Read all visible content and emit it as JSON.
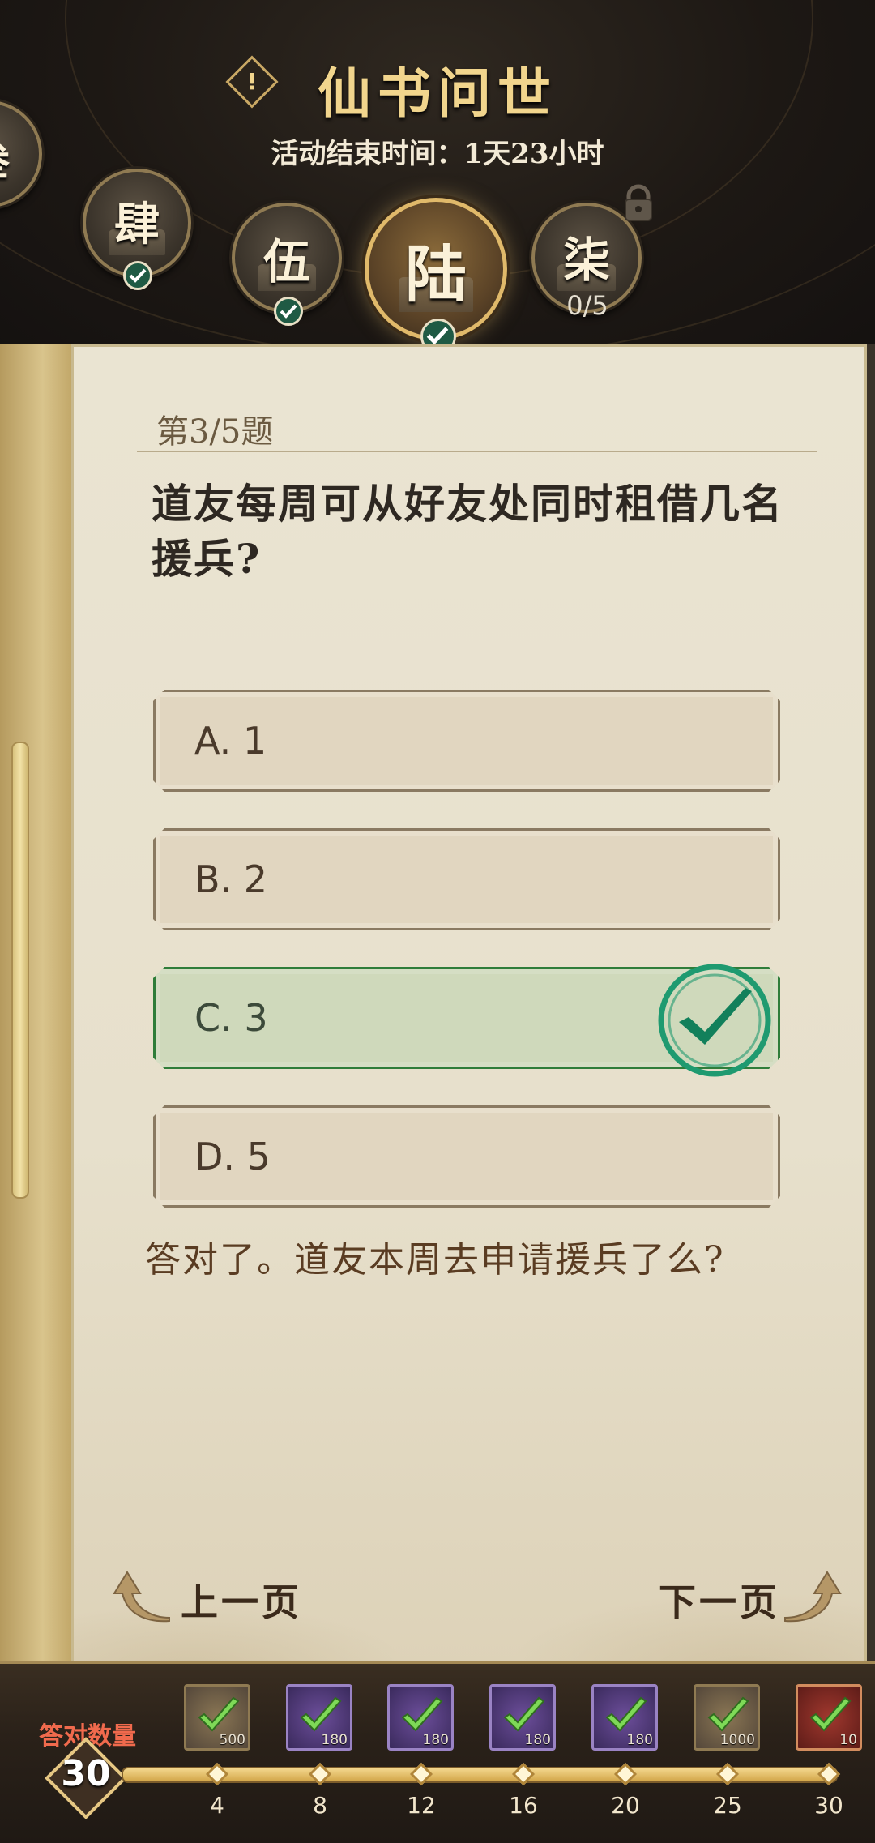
{
  "header": {
    "title": "仙书问世",
    "subtitle": "活动结束时间：1天23小时",
    "info_icon": "info-icon",
    "chapters": [
      {
        "glyph": "叁",
        "done": true
      },
      {
        "glyph": "肆",
        "done": true
      },
      {
        "glyph": "伍",
        "done": true
      },
      {
        "glyph": "陆",
        "done": true,
        "active": true
      },
      {
        "glyph": "柒",
        "locked": true,
        "progress": "0/5"
      }
    ]
  },
  "quiz": {
    "question_number": "第3/5题",
    "question": "道友每周可从好友处同时租借几名援兵?",
    "options": [
      {
        "label": "A. 1",
        "correct": false
      },
      {
        "label": "B. 2",
        "correct": false
      },
      {
        "label": "C. 3",
        "correct": true
      },
      {
        "label": "D. 5",
        "correct": false
      }
    ],
    "feedback": "答对了。道友本周去申请援兵了么?",
    "prev_label": "上一页",
    "next_label": "下一页"
  },
  "rewards": {
    "count_label": "答对数量",
    "count": "30",
    "milestones": [
      "4",
      "8",
      "12",
      "16",
      "20",
      "25",
      "30"
    ],
    "items": [
      {
        "icon": "gold-chest-icon",
        "qty": "500",
        "claimed": true
      },
      {
        "icon": "purple-gem-icon",
        "qty": "180",
        "claimed": true
      },
      {
        "icon": "purple-gem-icon",
        "qty": "180",
        "claimed": true
      },
      {
        "icon": "purple-gem-icon",
        "qty": "180",
        "claimed": true
      },
      {
        "icon": "purple-gem-icon",
        "qty": "180",
        "claimed": true
      },
      {
        "icon": "gold-chest-icon",
        "qty": "1000",
        "claimed": true
      },
      {
        "icon": "red-book-icon",
        "qty": "10",
        "claimed": true
      }
    ],
    "colors": {
      "accent": "#e6c783",
      "label": "#f06a4d"
    }
  }
}
